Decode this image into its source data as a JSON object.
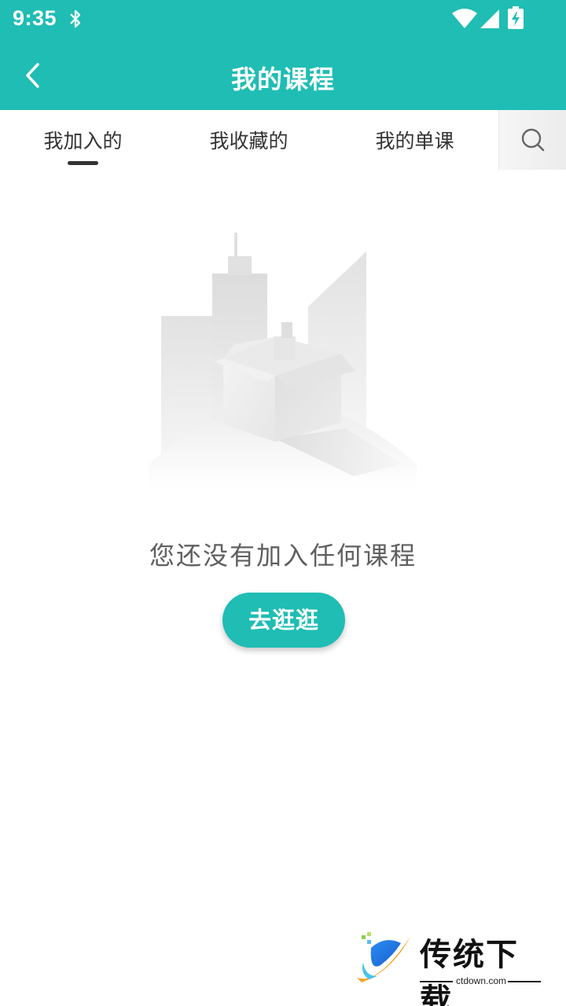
{
  "status_bar": {
    "time": "9:35",
    "icons": [
      "bluetooth-icon",
      "wifi-icon",
      "cell-signal-icon",
      "battery-charging-icon"
    ]
  },
  "app_bar": {
    "title": "我的课程",
    "back_icon": "chevron-left-icon"
  },
  "tabs": [
    {
      "label": "我加入的",
      "active": true
    },
    {
      "label": "我收藏的",
      "active": false
    },
    {
      "label": "我的单课",
      "active": false
    }
  ],
  "search": {
    "icon": "search-icon"
  },
  "empty_state": {
    "illustration": "empty-box-city-illustration",
    "message": "您还没有加入任何课程",
    "button_label": "去逛逛"
  },
  "watermark": {
    "brand": "传统下载",
    "domain": "ctdown.com"
  },
  "colors": {
    "primary": "#1fbdb4",
    "tab_text": "#333333",
    "message_text": "#5f5f5f"
  }
}
